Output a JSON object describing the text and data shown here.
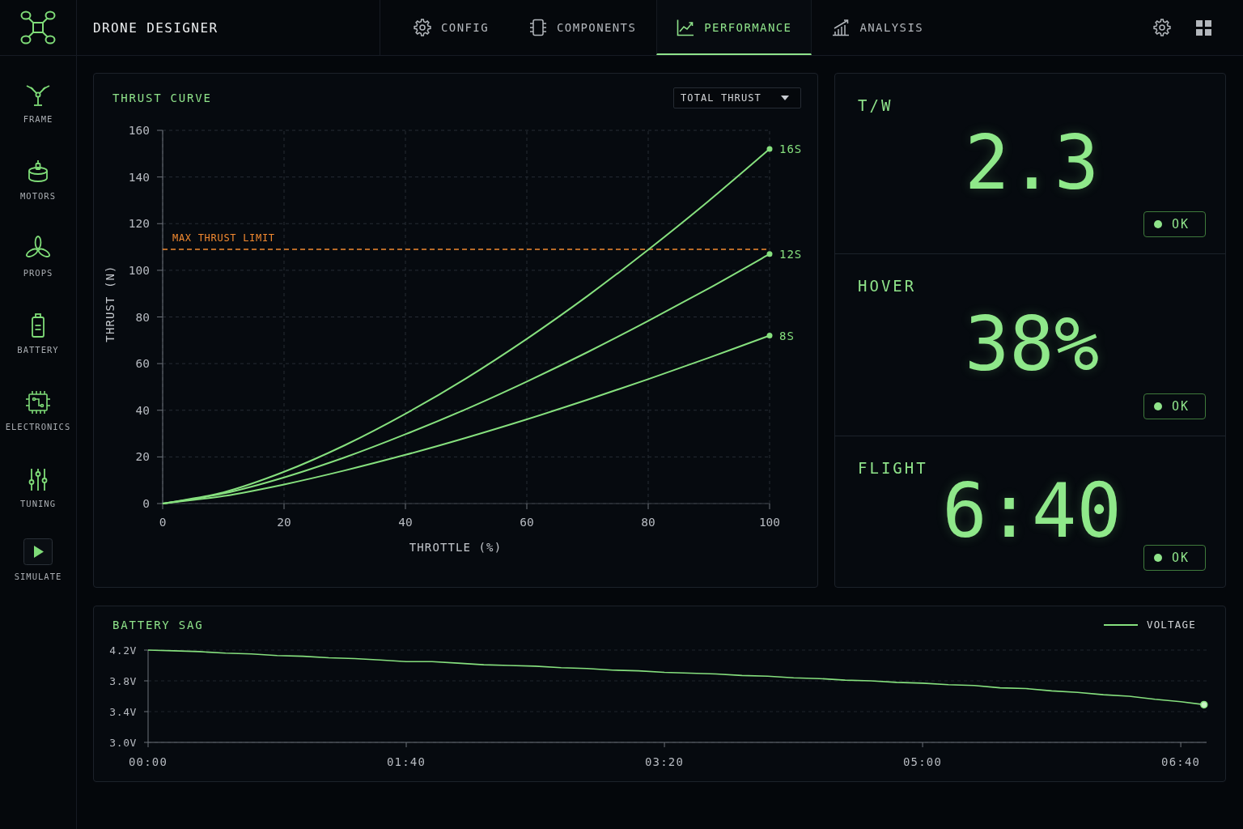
{
  "app": {
    "title": "DRONE DESIGNER"
  },
  "tabs": [
    {
      "label": "CONFIG",
      "selected": false
    },
    {
      "label": "COMPONENTS",
      "selected": false
    },
    {
      "label": "PERFORMANCE",
      "selected": true
    },
    {
      "label": "ANALYSIS",
      "selected": false
    }
  ],
  "sidebar": {
    "items": [
      {
        "label": "FRAME",
        "kind": "nav"
      },
      {
        "label": "MOTORS",
        "kind": "nav"
      },
      {
        "label": "PROPS",
        "kind": "nav"
      },
      {
        "label": "BATTERY",
        "kind": "nav"
      },
      {
        "label": "ELECTRONICS",
        "kind": "nav"
      },
      {
        "label": "TUNING",
        "kind": "nav"
      },
      {
        "label": "SIMULATE",
        "kind": "action"
      }
    ]
  },
  "thrust_panel": {
    "dropdown": {
      "value": "TOTAL THRUST"
    },
    "chart_data": {
      "type": "line",
      "title": "THRUST CURVE",
      "xlabel": "THROTTLE (%)",
      "ylabel": "THRUST (N)",
      "x": [
        0,
        10,
        20,
        30,
        40,
        50,
        60,
        70,
        80,
        90,
        100
      ],
      "series": [
        {
          "name": "16S",
          "color": "#86e07e",
          "values": [
            0,
            4.8,
            13.6,
            25.0,
            38.5,
            53.7,
            70.6,
            89.0,
            108.8,
            129.8,
            152
          ]
        },
        {
          "name": "12S",
          "color": "#86e07e",
          "values": [
            0,
            4.3,
            11.2,
            19.8,
            29.7,
            40.5,
            52.3,
            64.9,
            78.3,
            92.3,
            107
          ]
        },
        {
          "name": "8S",
          "color": "#86e07e",
          "values": [
            0,
            3.2,
            8.2,
            14.2,
            20.9,
            28.2,
            36.1,
            44.5,
            53.3,
            62.5,
            72
          ]
        }
      ],
      "xlim": [
        0,
        100
      ],
      "ylim": [
        0,
        160
      ],
      "xticks": [
        0,
        20,
        40,
        60,
        80,
        100
      ],
      "yticks": [
        0,
        20,
        40,
        60,
        80,
        100,
        120,
        140,
        160
      ],
      "grid": true,
      "ref_lines": [
        {
          "axis": "y",
          "value": 109,
          "label": "MAX THRUST LIMIT",
          "color": "#f28a30"
        }
      ]
    }
  },
  "metrics": [
    {
      "label": "T/W",
      "value": "2.3",
      "status": {
        "label": "OK",
        "kind": "ok"
      }
    },
    {
      "label": "HOVER",
      "value": "38%",
      "status": {
        "label": "OK",
        "kind": "ok"
      }
    },
    {
      "label": "FLIGHT",
      "value": "6:40",
      "status": {
        "label": "OK",
        "kind": "ok"
      }
    }
  ],
  "battery_panel": {
    "chart_data": {
      "type": "line",
      "title": "BATTERY SAG",
      "x": [
        0,
        10,
        20,
        30,
        40,
        50,
        60,
        70,
        80,
        90,
        100,
        110,
        120,
        130,
        140,
        150,
        160,
        170,
        180,
        190,
        200,
        210,
        220,
        230,
        240,
        250,
        260,
        270,
        280,
        290,
        300,
        310,
        320,
        330,
        340,
        350,
        360,
        370,
        380,
        390,
        400,
        409
      ],
      "series": [
        {
          "name": "VOLTAGE",
          "color": "#86e07e",
          "values": [
            4.2,
            4.19,
            4.18,
            4.16,
            4.15,
            4.13,
            4.12,
            4.1,
            4.09,
            4.07,
            4.05,
            4.05,
            4.03,
            4.01,
            4.0,
            3.99,
            3.97,
            3.96,
            3.94,
            3.93,
            3.91,
            3.9,
            3.89,
            3.87,
            3.86,
            3.84,
            3.83,
            3.81,
            3.8,
            3.78,
            3.77,
            3.75,
            3.74,
            3.71,
            3.7,
            3.67,
            3.65,
            3.62,
            3.6,
            3.56,
            3.53,
            3.49
          ]
        }
      ],
      "xlim": [
        0,
        410
      ],
      "ylim": [
        3.0,
        4.2
      ],
      "xticks": [
        {
          "value": 0,
          "label": "00:00"
        },
        {
          "value": 100,
          "label": "01:40"
        },
        {
          "value": 200,
          "label": "03:20"
        },
        {
          "value": 300,
          "label": "05:00"
        },
        {
          "value": 400,
          "label": "06:40"
        }
      ],
      "yticks": [
        {
          "value": 3.0,
          "label": "3.0V"
        },
        {
          "value": 3.4,
          "label": "3.4V"
        },
        {
          "value": 3.8,
          "label": "3.8V"
        },
        {
          "value": 4.2,
          "label": "4.2V"
        }
      ],
      "grid": true
    }
  }
}
